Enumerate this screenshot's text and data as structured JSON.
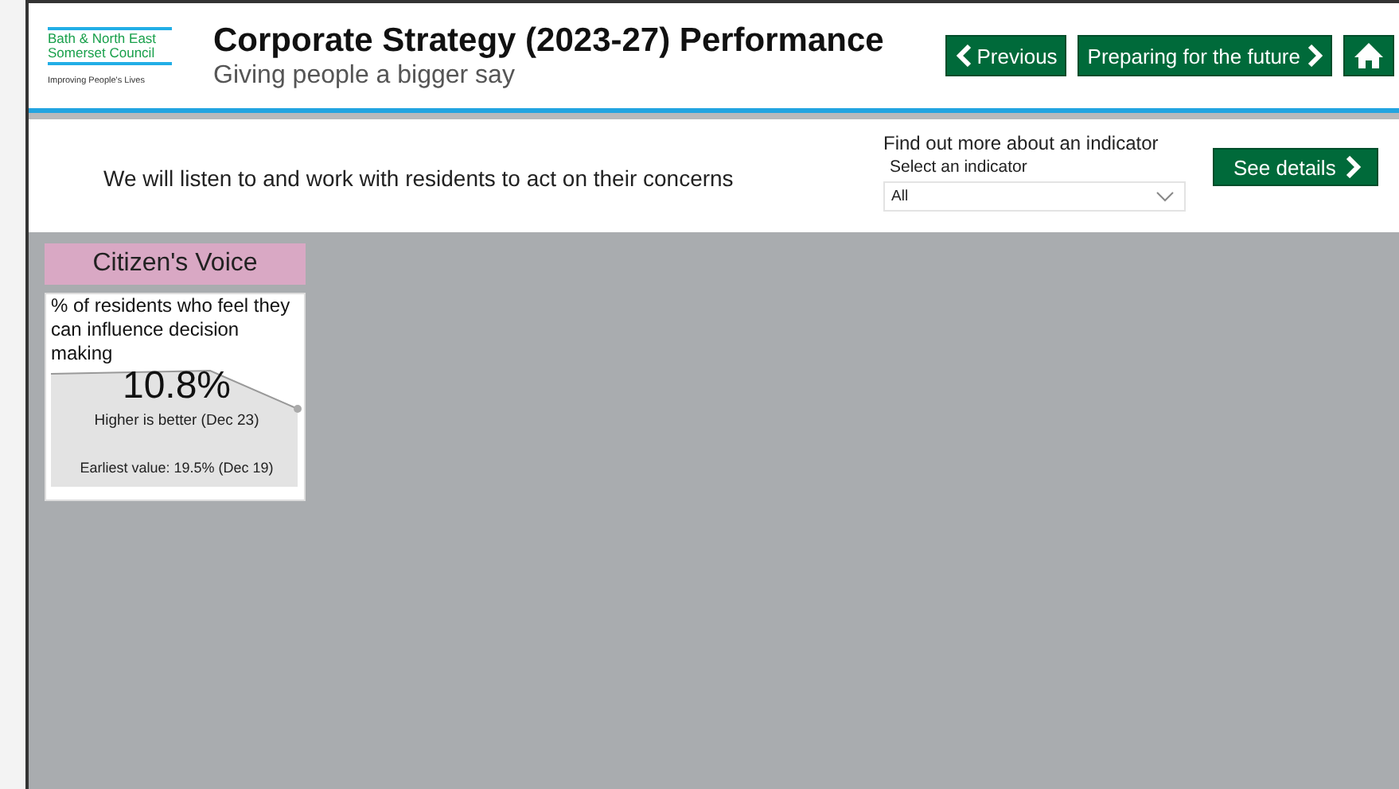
{
  "logo": {
    "lines": [
      "Bath & North East",
      "Somerset Council"
    ],
    "tagline": "Improving People's Lives"
  },
  "header": {
    "title": "Corporate Strategy (2023-27) Performance",
    "subtitle": "Giving people a bigger say"
  },
  "nav": {
    "previous": "Previous",
    "next": "Preparing for the future"
  },
  "banner": {
    "statement": "We will listen to and work with residents to act on their concerns",
    "find_heading": "Find out more about an indicator",
    "select_label": "Select an indicator",
    "select_value": "All",
    "details_button": "See details"
  },
  "category": {
    "title": "Citizen's Voice"
  },
  "cards": [
    {
      "title": "% of residents who feel they can influence decision making",
      "value": "10.8%",
      "direction": "Higher is better (Dec 23)",
      "earliest": "Earliest value: 19.5% (Dec 19)"
    }
  ]
}
